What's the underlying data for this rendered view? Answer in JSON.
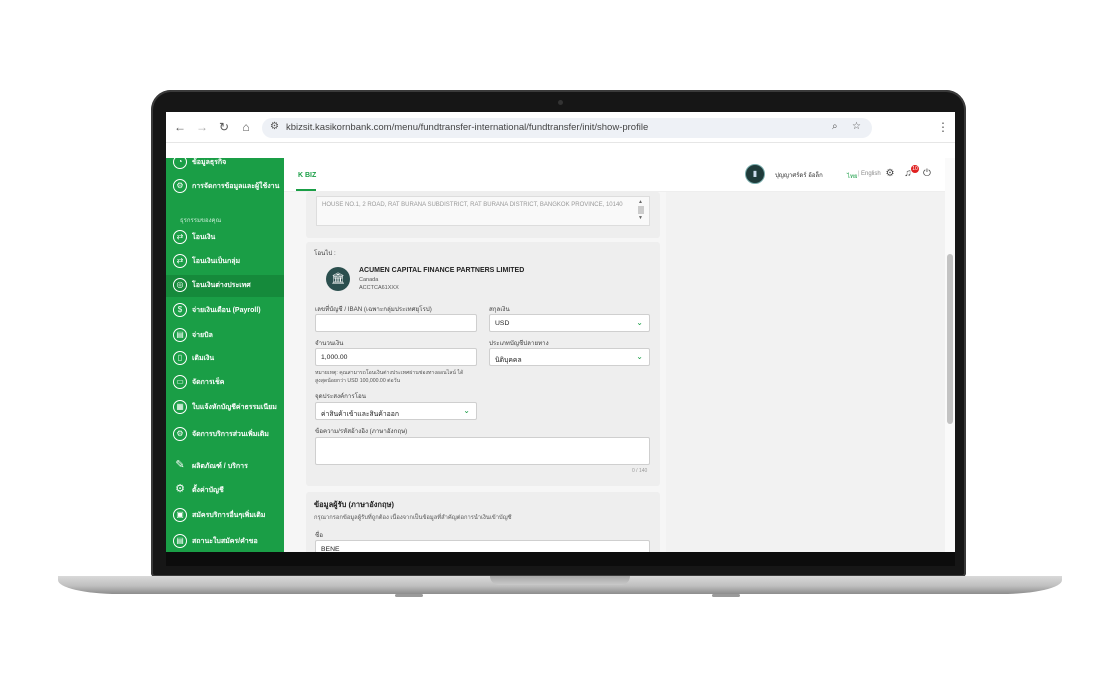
{
  "browser": {
    "url": "kbizsit.kasikornbank.com/menu/fundtransfer-international/fundtransfer/init/show-profile"
  },
  "sidebar": {
    "section_label": "ธุรกรรมของคุณ",
    "items": [
      {
        "label": "ข้อมูลธุรกิจ"
      },
      {
        "label": "การจัดการข้อมูลและผู้ใช้งาน"
      },
      {
        "label": "โอนเงิน"
      },
      {
        "label": "โอนเงินเป็นกลุ่ม"
      },
      {
        "label": "โอนเงินต่างประเทศ"
      },
      {
        "label": "จ่ายเงินเดือน (Payroll)"
      },
      {
        "label": "จ่ายบิล"
      },
      {
        "label": "เติมเงิน"
      },
      {
        "label": "จัดการเช็ค"
      },
      {
        "label": "ใบแจ้งหักบัญชีค่าธรรมเนียม"
      },
      {
        "label": "จัดการบริการส่วนเพิ่มเติม"
      },
      {
        "label": "ผลิตภัณฑ์ / บริการ"
      },
      {
        "label": "ตั้งค่าบัญชี"
      },
      {
        "label": "สมัครบริการอื่นๆเพิ่มเติม"
      },
      {
        "label": "สถานะใบสมัคร/คำขอ"
      }
    ]
  },
  "header": {
    "tab": "K BIZ",
    "user_name": "ปุญญาศร์ดร์ อ้อล็ก",
    "lang_th": "ไทย",
    "lang_sep": "|",
    "lang_en": "English",
    "notification_count": "10"
  },
  "form": {
    "address": "HOUSE NO.1, 2 ROAD, RAT BURANA SUBDISTRICT, RAT BURANA DISTRICT, BANGKOK PROVINCE, 10140",
    "transfer_to_label": "โอนไป :",
    "bank_name": "ACUMEN CAPITAL FINANCE PARTNERS LIMITED",
    "bank_country": "Canada",
    "bank_code": "ACCTCA61XXX",
    "account_label": "เลขที่บัญชี / IBAN (เฉพาะกลุ่มประเทศยุโรป)",
    "account_value": "",
    "currency_label": "สกุลเงิน",
    "currency_value": "USD",
    "amount_label": "จำนวนเงิน",
    "amount_value": "1,000.00",
    "dest_type_label": "ประเภทบัญชีปลายทาง",
    "dest_type_value": "นิติบุคคล",
    "amount_note": "หมายเหตุ: คุณสามารถโอนเงินต่างประเทศผ่านช่องทางออนไลน์ ได้สูงสุดน้อยกว่า USD 100,000.00 ต่อวัน",
    "purpose_label": "จุดประสงค์การโอน",
    "purpose_value": "ค่าสินค้าเข้าและสินค้าออก",
    "message_label": "ข้อความ/รหัสอ้างอิง (ภาษาอังกฤษ)",
    "message_value": "",
    "message_counter": "0 / 140",
    "recipient_title": "ข้อมูลผู้รับ (ภาษาอังกฤษ)",
    "recipient_desc": "กรุณากรอกข้อมูลผู้รับที่ถูกต้อง เนื่องจากเป็นข้อมูลที่สำคัญต่อการนำเงินเข้าบัญชี",
    "name_label": "ชื่อ",
    "name_value": "BENE"
  }
}
